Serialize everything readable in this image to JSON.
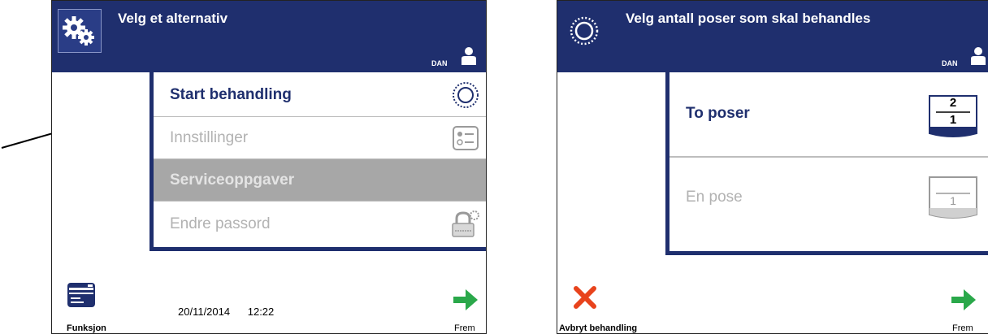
{
  "left_screen": {
    "header": {
      "title": "Velg et alternativ",
      "lang": "DAN"
    },
    "menu": {
      "items": [
        {
          "label": "Start behandling",
          "state": "active",
          "icon": "sun-icon"
        },
        {
          "label": "Innstillinger",
          "state": "disabled",
          "icon": "settings-list-icon"
        },
        {
          "label": "Serviceoppgaver",
          "state": "selected",
          "icon": ""
        },
        {
          "label": "Endre passord",
          "state": "disabled",
          "icon": "lock-icon"
        }
      ]
    },
    "footer": {
      "function_label": "Funksjon",
      "date": "20/11/2014",
      "time": "12:22",
      "next_label": "Frem"
    }
  },
  "right_screen": {
    "header": {
      "title": "Velg antall poser som skal behandles",
      "lang": "DAN"
    },
    "options": [
      {
        "label": "To poser",
        "state": "active",
        "icon_top": "2",
        "icon_bottom": "1"
      },
      {
        "label": "En pose",
        "state": "disabled",
        "icon_top": "",
        "icon_bottom": "1"
      }
    ],
    "footer": {
      "cancel_label": "Avbryt behandling",
      "next_label": "Frem"
    }
  },
  "colors": {
    "header_bg": "#1f2f6e",
    "next_arrow": "#2aa84a",
    "cancel_x": "#e8431c",
    "disabled_text": "#b2b2b2",
    "selected_bg": "#a7a7a7"
  }
}
